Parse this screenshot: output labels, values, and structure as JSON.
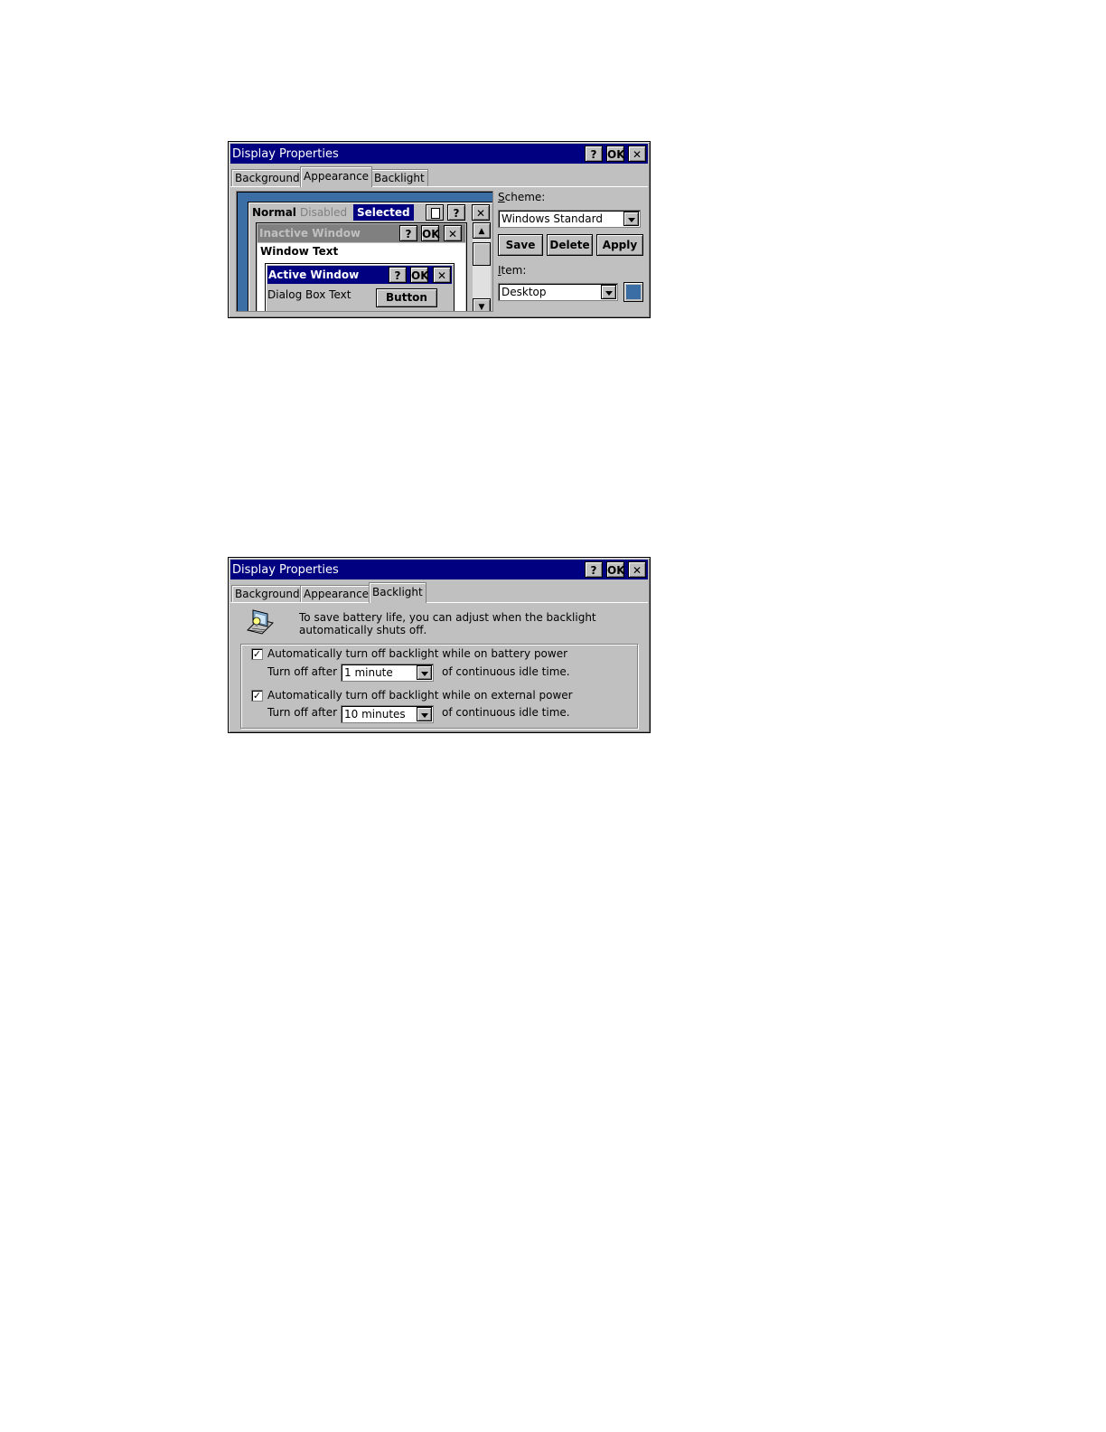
{
  "dialog1": {
    "title": "Display Properties",
    "title_buttons": {
      "help": "?",
      "ok": "OK",
      "close": "✕"
    },
    "tabs": [
      "Background",
      "Appearance",
      "Backlight"
    ],
    "active_tab": "Appearance",
    "preview": {
      "menu": {
        "normal": "Normal",
        "disabled": "Disabled",
        "selected": "Selected"
      },
      "inactive_window": "Inactive Window",
      "window_text": "Window Text",
      "active_window": "Active Window",
      "dialog_text": "Dialog Box Text",
      "button": "Button",
      "btn_help": "?",
      "btn_ok": "OK",
      "btn_close": "✕"
    },
    "scheme_label_pre": "S",
    "scheme_label_rest": "cheme:",
    "scheme_value": "Windows Standard",
    "buttons": {
      "save": "Save",
      "delete": "Delete",
      "apply": "Apply"
    },
    "item_label_pre": "I",
    "item_label_rest": "tem:",
    "item_value": "Desktop",
    "item_color": "#3a6ea5",
    "desktop_color": "#3a6ea5"
  },
  "dialog2": {
    "title": "Display Properties",
    "title_buttons": {
      "help": "?",
      "ok": "OK",
      "close": "✕"
    },
    "tabs": [
      "Background",
      "Appearance",
      "Backlight"
    ],
    "active_tab": "Backlight",
    "info_line1": "To save battery life, you can adjust when the backlight",
    "info_line2": "automatically shuts off.",
    "battery": {
      "checked": true,
      "check_mark": "✓",
      "label": "Automatically turn off backlight while on battery power",
      "turn_off_label": "Turn off after",
      "value": "1 minute",
      "suffix": "of continuous idle time."
    },
    "external": {
      "checked": true,
      "check_mark": "✓",
      "label": "Automatically turn off backlight while on external power",
      "turn_off_label": "Turn off after",
      "value": "10 minutes",
      "suffix": "of continuous idle time."
    }
  }
}
